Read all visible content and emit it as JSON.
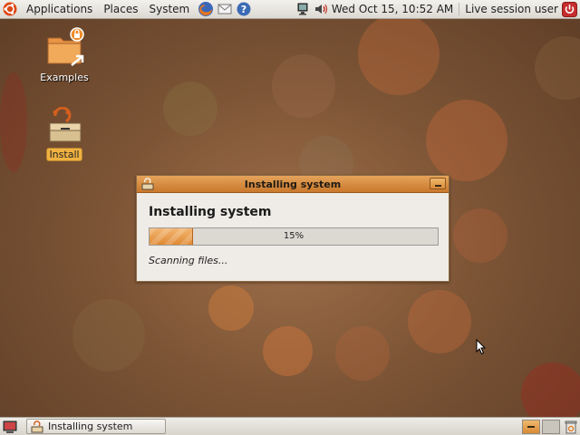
{
  "top_panel": {
    "menus": [
      "Applications",
      "Places",
      "System"
    ],
    "clock": "Wed Oct 15, 10:52 AM",
    "user": "Live session user",
    "launchers": [
      "firefox-icon",
      "mail-icon",
      "help-icon"
    ],
    "tray_icons": [
      "network-icon",
      "volume-icon"
    ]
  },
  "desktop": {
    "icons": [
      {
        "label": "Examples",
        "icon": "examples-folder-icon"
      },
      {
        "label": "Install",
        "icon": "install-icon"
      }
    ]
  },
  "dialog": {
    "title": "Installing system",
    "heading": "Installing system",
    "progress_text": "15%",
    "progress_value": 0.15,
    "status": "Scanning files..."
  },
  "bottom_panel": {
    "task_label": "Installing system"
  },
  "colors": {
    "accent": "#d98b36",
    "titlebar": "#c9782c",
    "desktop": "#7d5536"
  }
}
